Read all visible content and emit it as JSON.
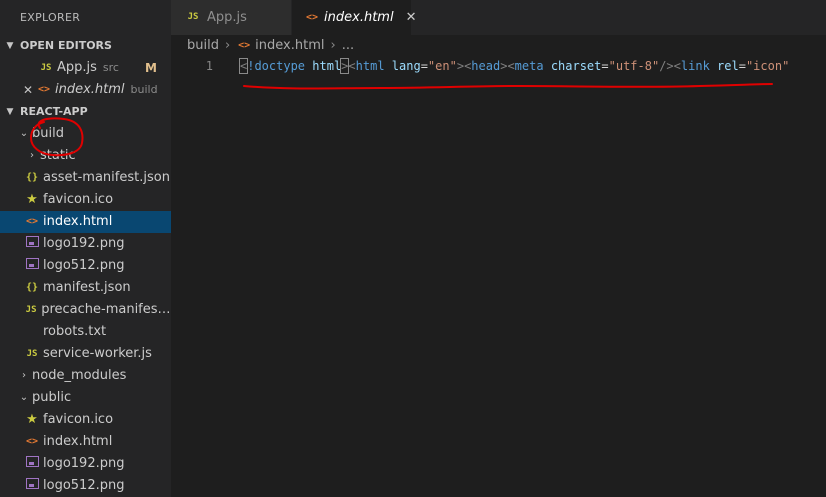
{
  "explorer": {
    "title": "EXPLORER",
    "open_editors": {
      "title": "OPEN EDITORS",
      "items": [
        {
          "icon": "JS",
          "name": "App.js",
          "desc": "src",
          "badge": "M"
        },
        {
          "icon": "<>",
          "name": "index.html",
          "desc": "build",
          "close": "✕"
        }
      ]
    },
    "project": {
      "title": "REACT-APP",
      "items": [
        {
          "type": "folder",
          "name": "build",
          "expanded": true
        },
        {
          "type": "folder",
          "name": "static",
          "expanded": false
        },
        {
          "type": "file",
          "icon": "{}",
          "name": "asset-manifest.json"
        },
        {
          "type": "file",
          "icon": "★",
          "name": "favicon.ico"
        },
        {
          "type": "file",
          "icon": "<>",
          "name": "index.html",
          "selected": true
        },
        {
          "type": "file",
          "icon": "img",
          "name": "logo192.png"
        },
        {
          "type": "file",
          "icon": "img",
          "name": "logo512.png"
        },
        {
          "type": "file",
          "icon": "{}",
          "name": "manifest.json"
        },
        {
          "type": "file",
          "icon": "JS",
          "name": "precache-manifest.b..."
        },
        {
          "type": "file",
          "icon": "",
          "name": "robots.txt"
        },
        {
          "type": "file",
          "icon": "JS",
          "name": "service-worker.js"
        },
        {
          "type": "folder",
          "name": "node_modules",
          "expanded": false
        },
        {
          "type": "folder",
          "name": "public",
          "expanded": true
        },
        {
          "type": "file",
          "icon": "★",
          "name": "favicon.ico"
        },
        {
          "type": "file",
          "icon": "<>",
          "name": "index.html"
        },
        {
          "type": "file",
          "icon": "img",
          "name": "logo192.png"
        },
        {
          "type": "file",
          "icon": "img",
          "name": "logo512.png"
        }
      ]
    }
  },
  "tabs": [
    {
      "icon": "JS",
      "label": "App.js",
      "active": false
    },
    {
      "icon": "<>",
      "label": "index.html",
      "active": true,
      "close": "✕"
    }
  ],
  "breadcrumb": {
    "folder": "build",
    "file_icon": "<>",
    "file": "index.html",
    "more": "..."
  },
  "editor": {
    "line_number": "1",
    "tokens": {
      "lt1": "<",
      "doctype": "!doctype",
      "html_kw": "html",
      "gt1": ">",
      "lt2": "<",
      "html_tag": "html",
      "lang_attr": "lang",
      "eq1": "=",
      "lang_val": "\"en\"",
      "gt2": ">",
      "lt3": "<",
      "head_tag": "head",
      "gt3": ">",
      "lt4": "<",
      "meta_tag": "meta",
      "charset_attr": "charset",
      "eq2": "=",
      "charset_val": "\"utf-8\"",
      "close4": "/>",
      "lt5": "<",
      "link_tag": "link",
      "rel_attr": "rel",
      "eq3": "=",
      "rel_val": "\"icon\""
    }
  },
  "colors": {
    "annotation": "#e00000",
    "accent": "#094771",
    "modified_badge": "#e2c08d"
  }
}
